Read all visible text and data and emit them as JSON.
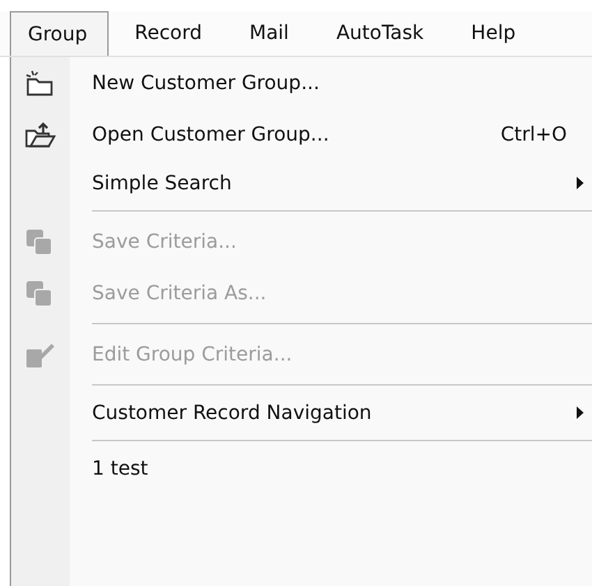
{
  "menubar": [
    {
      "label": "Group",
      "selected": true
    },
    {
      "label": "Record",
      "selected": false
    },
    {
      "label": "Mail",
      "selected": false
    },
    {
      "label": "AutoTask",
      "selected": false
    },
    {
      "label": "Help",
      "selected": false
    }
  ],
  "menu": [
    {
      "kind": "command",
      "label": "New Customer Group...",
      "disabled": false
    },
    {
      "kind": "command",
      "label": "Open Customer Group...",
      "shortcut": "Ctrl+O",
      "disabled": false
    },
    {
      "kind": "submenu",
      "label": "Simple Search",
      "disabled": false
    },
    {
      "kind": "separator"
    },
    {
      "kind": "command",
      "label": "Save Criteria...",
      "disabled": true
    },
    {
      "kind": "command",
      "label": "Save Criteria As...",
      "disabled": true
    },
    {
      "kind": "separator"
    },
    {
      "kind": "command",
      "label": "Edit Group Criteria...",
      "disabled": true
    },
    {
      "kind": "separator"
    },
    {
      "kind": "submenu",
      "label": "Customer Record Navigation",
      "disabled": false
    },
    {
      "kind": "separator"
    },
    {
      "kind": "command",
      "label": "1 test",
      "disabled": false
    }
  ]
}
